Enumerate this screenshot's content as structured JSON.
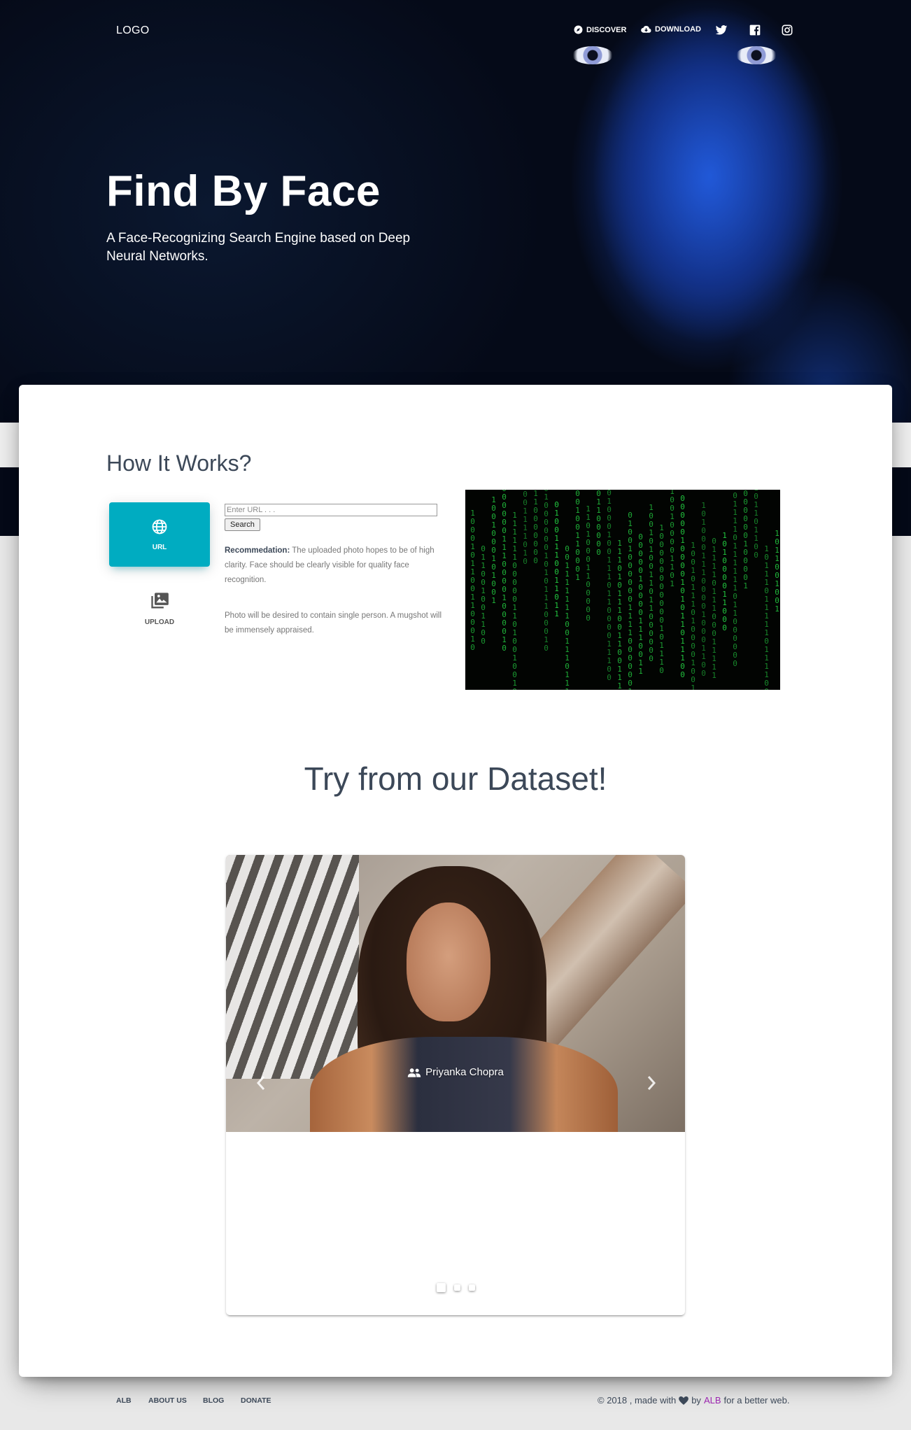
{
  "nav": {
    "logo": "LOGO",
    "discover": "DISCOVER",
    "download": "DOWNLOAD",
    "social_icons": [
      "twitter-icon",
      "facebook-icon",
      "instagram-icon"
    ]
  },
  "hero": {
    "title": "Find By Face",
    "subtitle": "A Face-Recognizing Search Engine based on Deep Neural Networks."
  },
  "how_it_works": {
    "title": "How It Works?",
    "tabs": [
      {
        "label": "URL",
        "icon": "globe-icon",
        "active": true
      },
      {
        "label": "UPLOAD",
        "icon": "photo-library-icon",
        "active": false
      }
    ],
    "url_placeholder": "Enter URL . . .",
    "search_label": "Search",
    "recommendation_label": "Recommedation:",
    "recommendation_text": " The uploaded photo hopes to be of high clarity. Face should be clearly visible for quality face recognition.",
    "note": "Photo will be desired to contain single person. A mugshot will be immensely appraised."
  },
  "dataset": {
    "title": "Try from our Dataset!",
    "slide_caption": "Priyanka Chopra",
    "slide_count": 3,
    "active_slide": 1
  },
  "footer": {
    "links": [
      "ALB",
      "ABOUT US",
      "BLOG",
      "DONATE"
    ],
    "copyright_prefix": "© 2018 , made with",
    "copyright_by": "by",
    "brand": "ALB",
    "copyright_suffix": "for a better web."
  },
  "colors": {
    "accent": "#00acc1",
    "brand": "#9c27b0",
    "text": "#3c4858"
  }
}
